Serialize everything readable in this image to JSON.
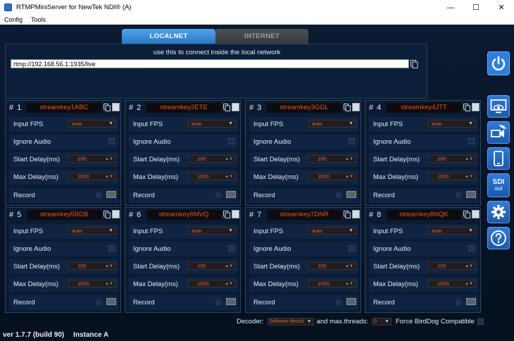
{
  "window": {
    "title": "RTMPMiniServer for NewTek NDI®  (A)",
    "controls": [
      "—",
      "☐",
      "✕"
    ]
  },
  "menu": [
    "Config",
    "Tools"
  ],
  "tabs": [
    {
      "label": "LOCALNET",
      "active": true
    },
    {
      "label": "INTERNET",
      "active": false
    }
  ],
  "connection": {
    "hint": "use this to connect inside the local network",
    "url": "rtmp://192.168.56.1:1935/live"
  },
  "row_labels": {
    "input_fps": "Input FPS",
    "ignore_audio": "Ignore Audio",
    "start_delay": "Start Delay(ms)",
    "max_delay": "Max Delay(ms)",
    "record": "Record"
  },
  "streams": [
    {
      "number": "# 1",
      "key": "streamkey1ABC",
      "fps": "auto",
      "start_delay": "100",
      "max_delay": "1000"
    },
    {
      "number": "# 2",
      "key": "streamkey2ETE",
      "fps": "auto",
      "start_delay": "100",
      "max_delay": "1000"
    },
    {
      "number": "# 3",
      "key": "streamkey3GGL",
      "fps": "auto",
      "start_delay": "100",
      "max_delay": "1000"
    },
    {
      "number": "# 4",
      "key": "streamkey4JTT",
      "fps": "auto",
      "start_delay": "100",
      "max_delay": "1000"
    },
    {
      "number": "# 5",
      "key": "streamkey5BDB",
      "fps": "auto",
      "start_delay": "100",
      "max_delay": "1000"
    },
    {
      "number": "# 6",
      "key": "streamkey6MVQ",
      "fps": "auto",
      "start_delay": "100",
      "max_delay": "1000"
    },
    {
      "number": "# 7",
      "key": "streamkey7DNR",
      "fps": "auto",
      "start_delay": "100",
      "max_delay": "1000"
    },
    {
      "number": "# 8",
      "key": "streamkey8NQK",
      "fps": "auto",
      "start_delay": "100",
      "max_delay": "1000"
    }
  ],
  "sidebar": {
    "sdi_line1": "SDI",
    "sdi_line2": "out"
  },
  "footer": {
    "decoder_label": "Decoder:",
    "decoder_value": "Software decod",
    "threads_label": "and max.threads:",
    "threads_value": "0",
    "birddog_label": "Force BirdDog Compatible",
    "version": "ver 1.7.7 (build 90)",
    "instance": "Instance A"
  },
  "colors": {
    "accent": "#2a78c4",
    "stream_key": "#e3541e",
    "panel_bg": "#0a1b33"
  }
}
